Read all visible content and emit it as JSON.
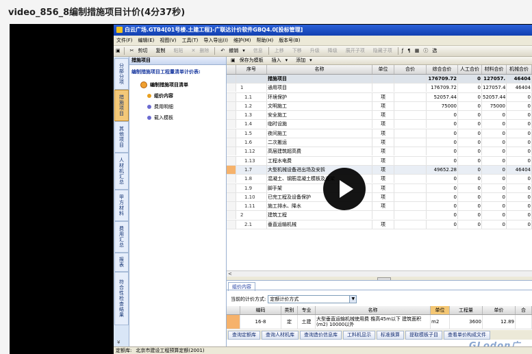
{
  "page_title": "video_856_8编制措施项目计价(4分37秒)",
  "window_title": "白云广场.GTB4[01号楼.土建工程]-广联达计价软件GBQ4.0[投标管理]",
  "menu": [
    "文件(F)",
    "编辑(E)",
    "视图(V)",
    "工具(T)",
    "导入导出(I)",
    "维护(M)",
    "帮助(H)",
    "版本号(B)"
  ],
  "toolbar": {
    "cut": "剪切",
    "copy": "复制",
    "paste": "粘贴",
    "delete": "删除",
    "undo": "撤销",
    "info": "信息",
    "up": "上移",
    "down": "下移",
    "upgrade": "升级",
    "downgrade": "降级",
    "expand": "展开子项",
    "collapse": "隐藏子项",
    "end": "选"
  },
  "left_nav": [
    {
      "label": "分部分项",
      "active": false
    },
    {
      "label": "措施项目",
      "active": true
    },
    {
      "label": "其他项目",
      "active": false
    },
    {
      "label": "人材机汇总",
      "active": false
    },
    {
      "label": "甲方材料",
      "active": false
    },
    {
      "label": "费用汇总",
      "active": false
    },
    {
      "label": "报表",
      "active": false
    },
    {
      "label": "符合性检查结果",
      "active": false
    }
  ],
  "tree": {
    "header": "措施项目",
    "subheader": "编制措施项目工程量清单计价表:",
    "root": "编制措施项目清单",
    "items": [
      "组价内容",
      "费用明细",
      "载入模板"
    ]
  },
  "subtoolbar": {
    "save_template": "保存为模板",
    "insert": "插入",
    "add": "添加"
  },
  "grid": {
    "columns": [
      "序号",
      "名称",
      "单位",
      "合价",
      "综合合价",
      "人工合价",
      "材料合价",
      "机械合价"
    ],
    "summary": {
      "name": "措施项目",
      "total": "176709.72",
      "labor": "0",
      "material": "127057.",
      "machine": "46404"
    },
    "rows": [
      {
        "code": "1",
        "name": "通用项目",
        "unit": "",
        "total": "176709.72",
        "labor": "0",
        "material": "127057.4",
        "machine": "46404",
        "level": 0,
        "highlight": false
      },
      {
        "code": "1.1",
        "name": "环境保护",
        "unit": "项",
        "total": "52057.44",
        "labor": "0",
        "material": "52057.44",
        "machine": "0",
        "level": 1,
        "highlight": false
      },
      {
        "code": "1.2",
        "name": "文明施工",
        "unit": "项",
        "total": "75000",
        "labor": "0",
        "material": "75000",
        "machine": "0",
        "level": 1,
        "highlight": false
      },
      {
        "code": "1.3",
        "name": "安全施工",
        "unit": "项",
        "total": "0",
        "labor": "0",
        "material": "0",
        "machine": "0",
        "level": 1,
        "highlight": false
      },
      {
        "code": "1.4",
        "name": "临时设施",
        "unit": "项",
        "total": "0",
        "labor": "0",
        "material": "0",
        "machine": "0",
        "level": 1,
        "highlight": false
      },
      {
        "code": "1.5",
        "name": "夜间施工",
        "unit": "项",
        "total": "0",
        "labor": "0",
        "material": "0",
        "machine": "0",
        "level": 1,
        "highlight": false
      },
      {
        "code": "1.6",
        "name": "二次搬运",
        "unit": "项",
        "total": "0",
        "labor": "0",
        "material": "0",
        "machine": "0",
        "level": 1,
        "highlight": false
      },
      {
        "code": "1.12",
        "name": "高层建筑超高费",
        "unit": "项",
        "total": "0",
        "labor": "0",
        "material": "0",
        "machine": "0",
        "level": 1,
        "highlight": false
      },
      {
        "code": "1.13",
        "name": "工程水电费",
        "unit": "项",
        "total": "0",
        "labor": "0",
        "material": "0",
        "machine": "0",
        "level": 1,
        "highlight": false
      },
      {
        "code": "1.7",
        "name": "大型机械设备进出场及安拆",
        "unit": "项",
        "total": "49652.28",
        "labor": "0",
        "material": "0",
        "machine": "46404",
        "level": 1,
        "highlight": true
      },
      {
        "code": "1.8",
        "name": "混凝土、钢筋混凝土模板及支架",
        "unit": "项",
        "total": "0",
        "labor": "0",
        "material": "0",
        "machine": "0",
        "level": 1,
        "highlight": false
      },
      {
        "code": "1.9",
        "name": "脚手架",
        "unit": "项",
        "total": "0",
        "labor": "0",
        "material": "0",
        "machine": "0",
        "level": 1,
        "highlight": false
      },
      {
        "code": "1.10",
        "name": "已完工程及设备保护",
        "unit": "项",
        "total": "0",
        "labor": "0",
        "material": "0",
        "machine": "0",
        "level": 1,
        "highlight": false
      },
      {
        "code": "1.11",
        "name": "施工排水、降水",
        "unit": "项",
        "total": "0",
        "labor": "0",
        "material": "0",
        "machine": "0",
        "level": 1,
        "highlight": false
      },
      {
        "code": "2",
        "name": "建筑工程",
        "unit": "",
        "total": "0",
        "labor": "0",
        "material": "0",
        "machine": "0",
        "level": 0,
        "highlight": false
      },
      {
        "code": "2.1",
        "name": "垂直运输机械",
        "unit": "项",
        "total": "0",
        "labor": "0",
        "material": "0",
        "machine": "0",
        "level": 1,
        "highlight": false
      }
    ]
  },
  "bottom": {
    "tab": "组价内容",
    "method_label": "当前的计价方式:",
    "method_value": "定额计价方式",
    "columns": [
      "编码",
      "类别",
      "专业",
      "名称",
      "单位",
      "工程量",
      "单价",
      "合"
    ],
    "row": {
      "code": "16-8",
      "type": "定",
      "major": "土建",
      "name": "大型垂直运输机械使用费 檐高45m以下 建筑面积(m2) 10000以外",
      "unit": "m2",
      "qty": "3600",
      "price": "12.89"
    },
    "watermark": "GLodon广"
  },
  "buttons": [
    "查询定额库",
    "查询人材机库",
    "查询造价信息库",
    "工料机显示",
    "标准换算",
    "提取模板子目",
    "查看单价构成文件"
  ],
  "status": {
    "lib_label": "定额库:",
    "lib_value": "北京市建设工程预算定额(2001)"
  }
}
